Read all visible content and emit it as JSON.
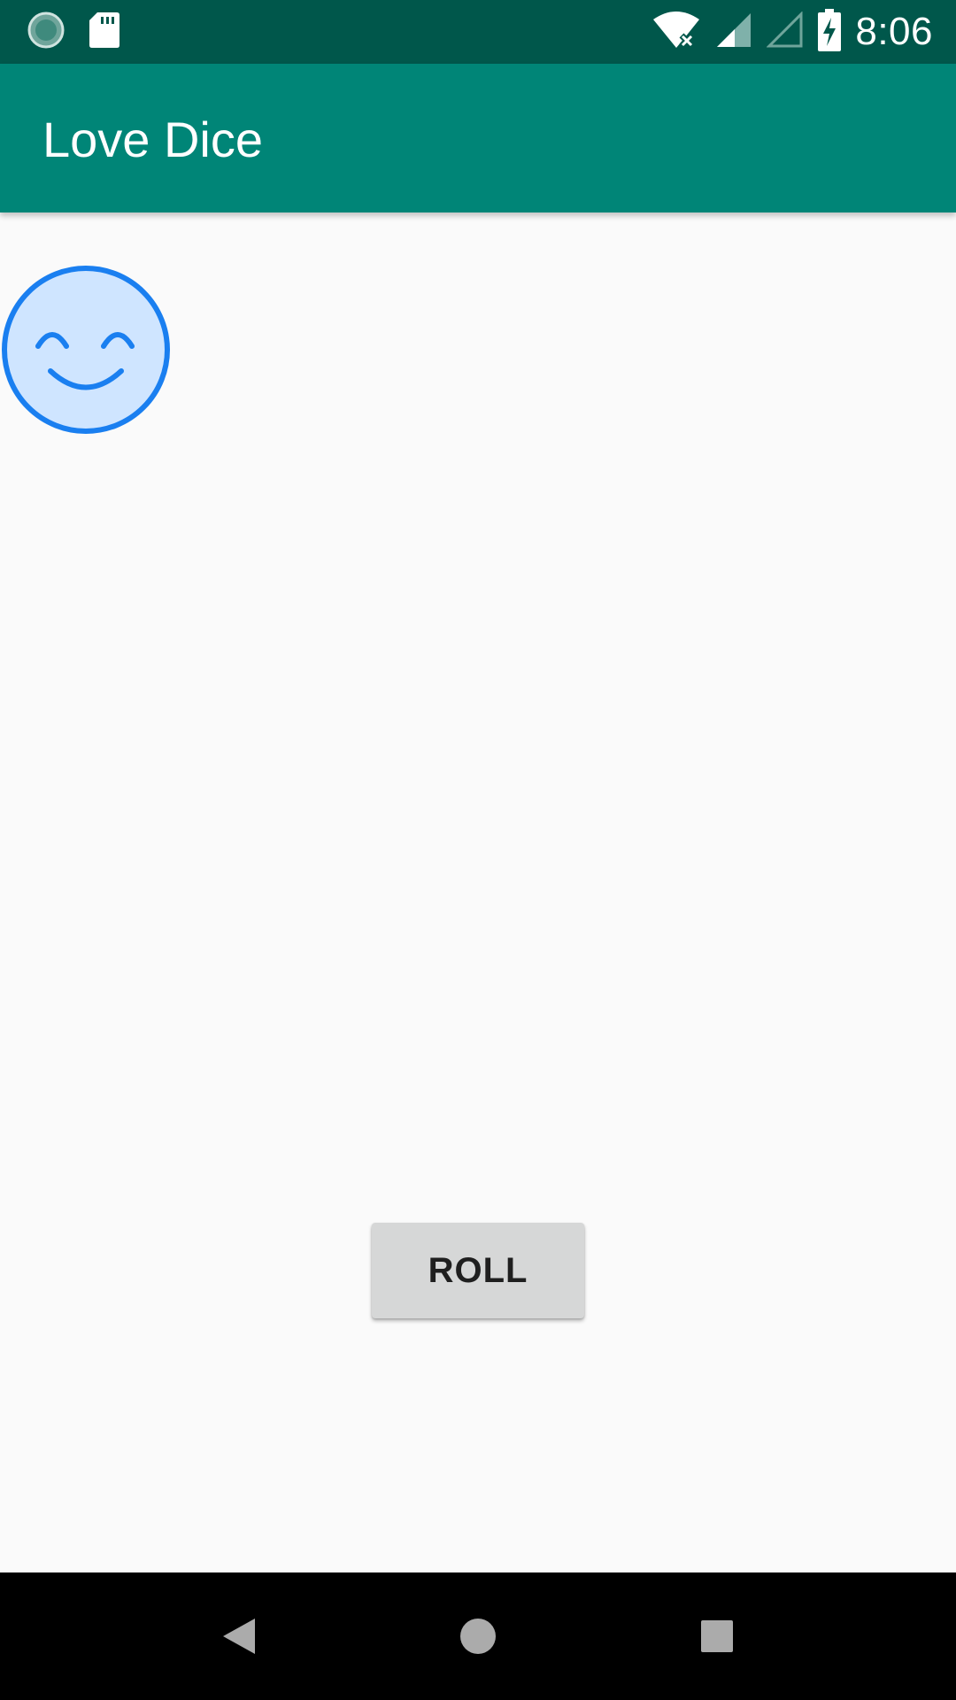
{
  "status_bar": {
    "time": "8:06",
    "icons": [
      "loading-circle-icon",
      "sd-card-icon",
      "wifi-off-icon",
      "signal-icon",
      "signal-empty-icon",
      "battery-charging-icon"
    ]
  },
  "app_bar": {
    "title": "Love Dice"
  },
  "main": {
    "dice_face": {
      "icon": "smiling-face-icon",
      "color": "#1a7ff0",
      "fill": "#cfe5ff"
    },
    "roll_button_label": "ROLL"
  },
  "nav_bar": {
    "buttons": [
      "back-icon",
      "home-icon",
      "recents-icon"
    ]
  },
  "colors": {
    "status_bar": "#00574b",
    "app_bar": "#008577",
    "background": "#fafafa",
    "button": "#d6d7d7",
    "nav_bar": "#000000"
  }
}
